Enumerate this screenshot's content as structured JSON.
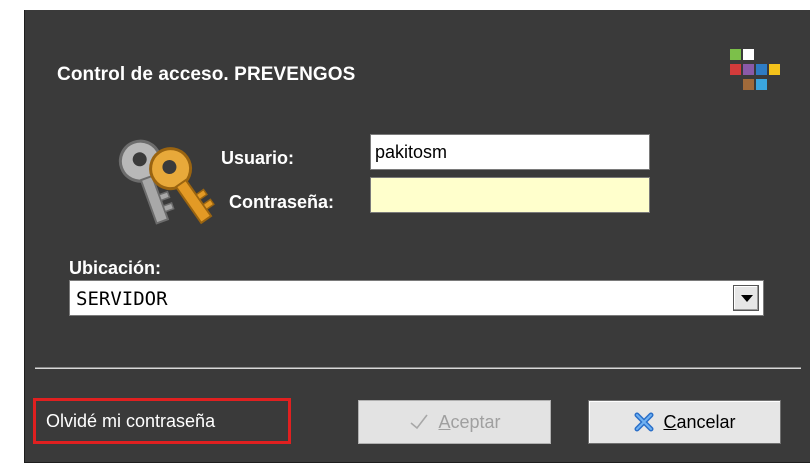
{
  "dialog": {
    "title": "Control de acceso. PREVENGOS",
    "logo_colors": [
      "#7cc04a",
      "#ffffff",
      "#d33b3b",
      "#8a5aa8",
      "#2e7cc4",
      "#f3c21b",
      "#a06a3a",
      "#3aa6e0"
    ]
  },
  "login": {
    "user_label": "Usuario:",
    "user_value": "pakitosm",
    "password_label": "Contraseña:",
    "password_value": "",
    "icon": "keys-icon"
  },
  "location": {
    "label": "Ubicación:",
    "selected": "SERVIDOR"
  },
  "actions": {
    "forgot": "Olvidé mi contraseña",
    "accept_first": "A",
    "accept_rest": "ceptar",
    "cancel_first": "C",
    "cancel_rest": "ancelar"
  },
  "colors": {
    "dialog_bg": "#3a3a3a",
    "highlight": "#e02020",
    "password_bg": "#ffffcc"
  }
}
